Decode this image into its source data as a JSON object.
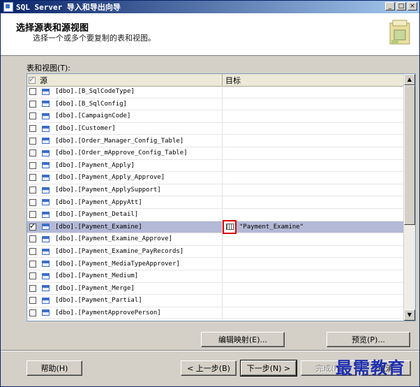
{
  "window": {
    "title": "SQL Server 导入和导出向导",
    "buttons": [
      "_",
      "□",
      "×"
    ]
  },
  "header": {
    "title": "选择源表和源视图",
    "subtitle": "选择一个或多个要复制的表和视图。"
  },
  "section_label": "表和视图(T):",
  "grid": {
    "columns": {
      "source": "源",
      "target": "目标"
    },
    "header_checked": true,
    "rows": [
      {
        "name": "[dbo].[B_SqlCodeType]",
        "checked": false,
        "target": ""
      },
      {
        "name": "[dbo].[B_SqlConfig]",
        "checked": false,
        "target": ""
      },
      {
        "name": "[dbo].[CampaignCode]",
        "checked": false,
        "target": ""
      },
      {
        "name": "[dbo].[Customer]",
        "checked": false,
        "target": ""
      },
      {
        "name": "[dbo].[Order_Manager_Config_Table]",
        "checked": false,
        "target": ""
      },
      {
        "name": "[dbo].[Order_mApprove_Config_Table]",
        "checked": false,
        "target": ""
      },
      {
        "name": "[dbo].[Payment_Apply]",
        "checked": false,
        "target": ""
      },
      {
        "name": "[dbo].[Payment_Apply_Approve]",
        "checked": false,
        "target": ""
      },
      {
        "name": "[dbo].[Payment_ApplySupport]",
        "checked": false,
        "target": ""
      },
      {
        "name": "[dbo].[Payment_AppyAtt]",
        "checked": false,
        "target": ""
      },
      {
        "name": "[dbo].[Payment_Detail]",
        "checked": false,
        "target": ""
      },
      {
        "name": "[dbo].[Payment_Examine]",
        "checked": true,
        "target": "\"Payment_Examine\""
      },
      {
        "name": "[dbo].[Payment_Examine_Approve]",
        "checked": false,
        "target": ""
      },
      {
        "name": "[dbo].[Payment_Examine_PayRecords]",
        "checked": false,
        "target": ""
      },
      {
        "name": "[dbo].[Payment_MediaTypeApprover]",
        "checked": false,
        "target": ""
      },
      {
        "name": "[dbo].[Payment_Medium]",
        "checked": false,
        "target": ""
      },
      {
        "name": "[dbo].[Payment_Merge]",
        "checked": false,
        "target": ""
      },
      {
        "name": "[dbo].[Payment_Partial]",
        "checked": false,
        "target": ""
      },
      {
        "name": "[dbo].[PaymentApprovePerson]",
        "checked": false,
        "target": ""
      }
    ]
  },
  "buttons": {
    "edit_mappings": "编辑映射(E)...",
    "preview": "预览(P)...",
    "help": "帮助(H)",
    "back": "< 上一步(B)",
    "next": "下一步(N) >",
    "finish": "完成(F)",
    "cancel": "取消"
  },
  "watermark": "最需教育",
  "icons": {
    "app": "sql-server-app-icon",
    "table": "table-icon",
    "destination": "destination-table-icon",
    "header_logo": "wizard-logo-icon"
  }
}
